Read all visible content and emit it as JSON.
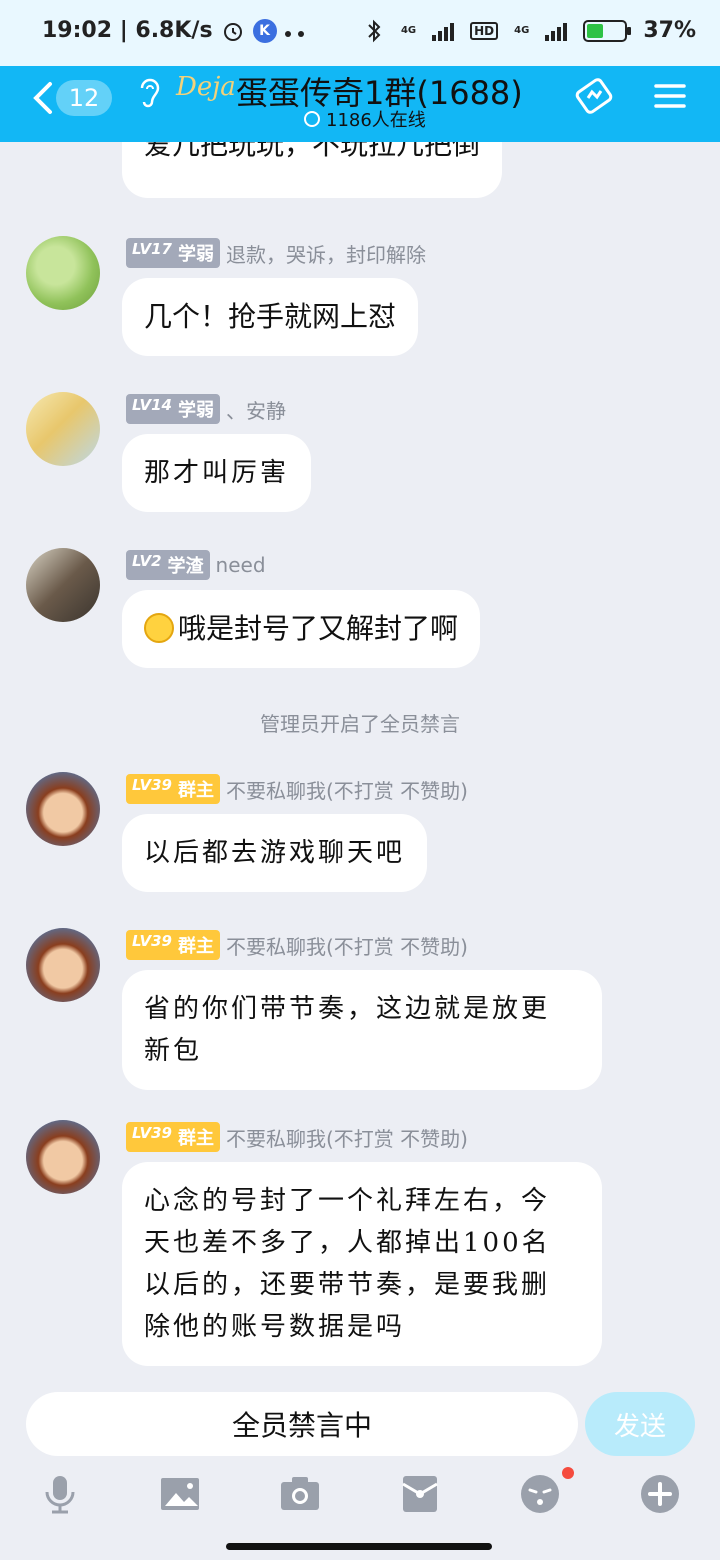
{
  "status_bar": {
    "time_speed": "19:02 | 6.8K/s",
    "battery_pct": "37%",
    "net_4g_a": "4G",
    "hd": "HD",
    "net_4g_b": "4G"
  },
  "header": {
    "unread_count": "12",
    "brand_logo": "Deja",
    "group_title": "蛋蛋传奇1群(1688)",
    "online_count": "1186人在线"
  },
  "messages": [
    {
      "level": "",
      "role": "",
      "name": "",
      "text": "爱几把玩玩，不玩拉几把倒"
    },
    {
      "level": "LV17",
      "role": "学弱",
      "name": "退款，哭诉，封印解除",
      "text": "几个！抢手就网上怼"
    },
    {
      "level": "LV14",
      "role": "学弱",
      "name": "、安静",
      "text": "那才叫厉害"
    },
    {
      "level": "LV2",
      "role": "学渣",
      "name": "need",
      "text": "哦是封号了又解封了啊"
    },
    {
      "level": "LV39",
      "role": "群主",
      "name": "不要私聊我(不打赏 不赞助)",
      "text": "以后都去游戏聊天吧"
    },
    {
      "level": "LV39",
      "role": "群主",
      "name": "不要私聊我(不打赏 不赞助)",
      "text_line1": "省的你们带节奏，这边就是放更",
      "text_line2": "新包"
    },
    {
      "level": "LV39",
      "role": "群主",
      "name": "不要私聊我(不打赏 不赞助)",
      "text_line1": "心念的号封了一个礼拜左右，今",
      "text_line2": "天也差不多了，人都掉出100名",
      "text_line3": "以后的，还要带节奏，是要我删",
      "text_line4": "除他的账号数据是吗"
    }
  ],
  "system_notice": "管理员开启了全员禁言",
  "input": {
    "muted_label": "全员禁言中",
    "send_label": "发送"
  },
  "toolbar_icons": [
    "microphone-icon",
    "image-icon",
    "camera-icon",
    "red-packet-icon",
    "emoji-icon",
    "plus-icon"
  ],
  "colors": {
    "header_bg": "#12b7f5",
    "chat_bg": "#eceef4",
    "owner_badge": "#ffc83b",
    "level_badge": "#a3a9b9",
    "send_disabled": "#b8ebfb"
  }
}
